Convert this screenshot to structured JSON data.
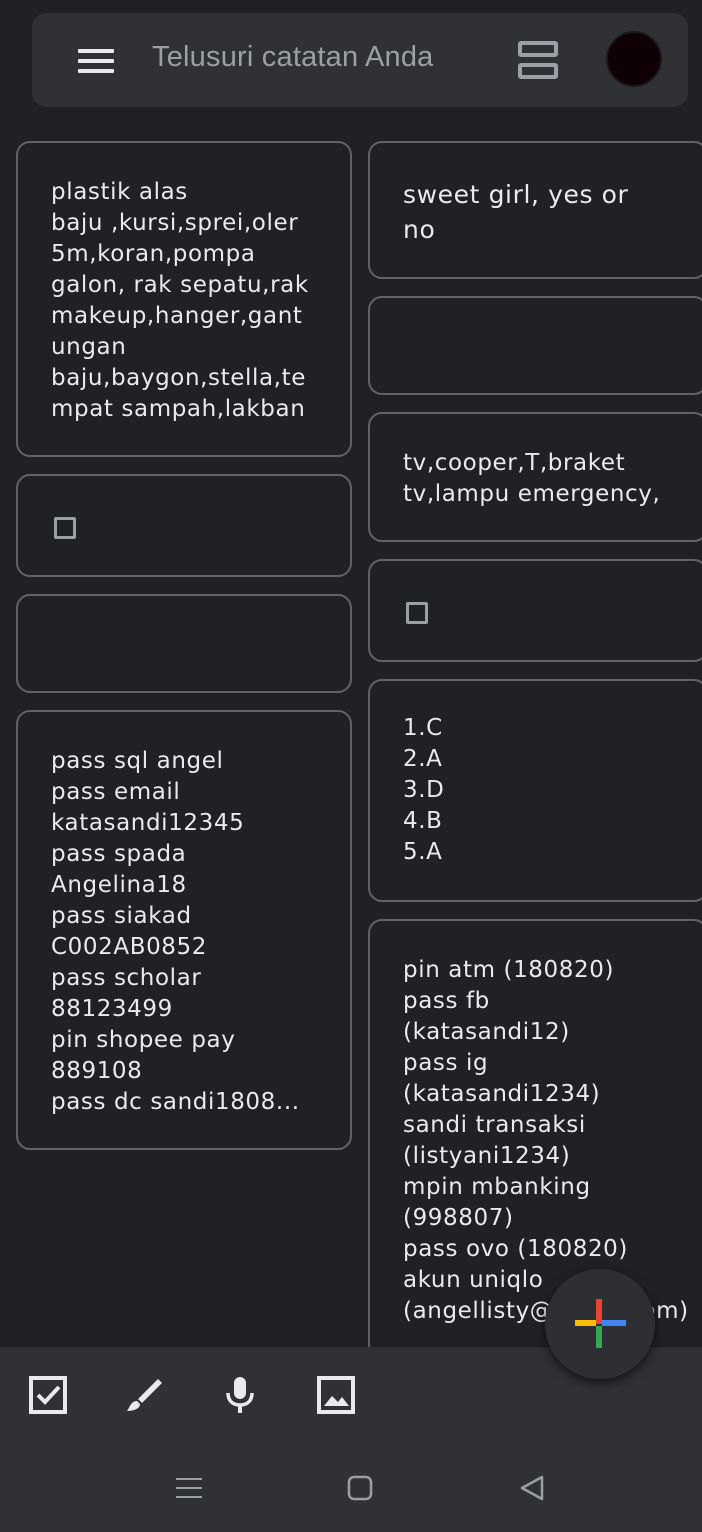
{
  "search": {
    "placeholder": "Telusuri catatan Anda"
  },
  "icons": {
    "menu": "menu-icon",
    "view_toggle": "list-view-icon",
    "avatar": "avatar",
    "checkbox": "checkbox-icon",
    "brush": "brush-icon",
    "mic": "mic-icon",
    "image": "image-icon",
    "add": "plus-icon"
  },
  "colors": {
    "background": "#202124",
    "surface": "#303134",
    "border": "#5f6368",
    "text": "#e8eaed",
    "google_red": "#ea4335",
    "google_blue": "#4285f4",
    "google_yellow": "#fbbc04",
    "google_green": "#34a853"
  },
  "notes": {
    "left": [
      {
        "text": "plastik alas\nbaju ,kursi,sprei,oler\n5m,koran,pompa\ngalon, rak sepatu,rak\nmakeup,hanger,gant\nungan\nbaju,baygon,stella,te\nmpat sampah,lakban"
      },
      {
        "text": ""
      },
      {
        "text": ""
      },
      {
        "text": "pass sql angel\npass email\nkatasandi12345\npass spada\nAngelina18\npass siakad\nC002AB0852\npass scholar\n88123499\npin shopee pay\n889108\npass dc sandi1808..."
      }
    ],
    "right": [
      {
        "text": "sweet girl, yes or\nno"
      },
      {
        "text": ""
      },
      {
        "text": "tv,cooper,T,braket\ntv,lampu emergency,"
      },
      {
        "text": ""
      },
      {
        "text": "1.C\n2.A\n3.D\n4.B\n5.A"
      },
      {
        "text": "pin atm (180820)\npass fb\n(katasandi12)\npass ig\n(katasandi1234)\nsandi transaksi\n(listyani1234)\nmpin mbanking\n(998807)\npass ovo (180820)\nakun uniqlo\n(angellisty@gmail.com)"
      }
    ]
  }
}
